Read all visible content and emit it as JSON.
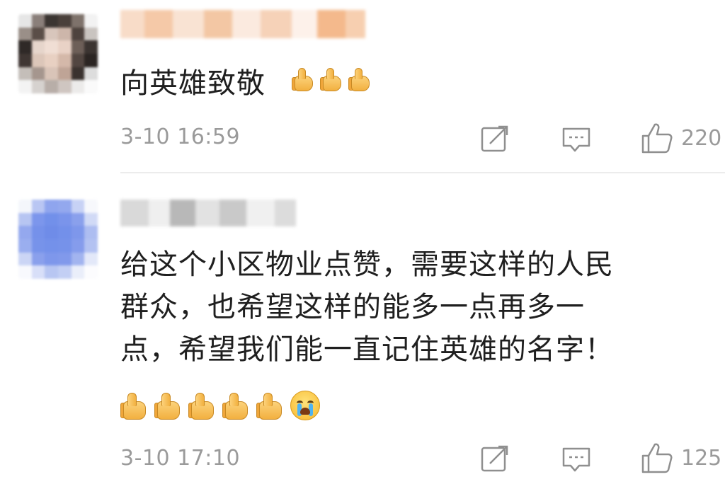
{
  "comments": [
    {
      "text": "向英雄致敬",
      "timestamp": "3-10 16:59",
      "emoji": [
        "thumbs-up",
        "thumbs-up",
        "thumbs-up"
      ],
      "like_count": "220"
    },
    {
      "text": "给这个小区物业点赞，需要这样的人民\n群众，也希望这样的能多一点再多一\n点，希望我们能一直记住英雄的名字！",
      "timestamp": "3-10 17:10",
      "emoji": [
        "thumbs-up",
        "thumbs-up",
        "thumbs-up",
        "thumbs-up",
        "thumbs-up",
        "crying-face"
      ],
      "like_count": "125"
    }
  ],
  "icons": {
    "share": "share-icon",
    "comment": "comment-icon",
    "like": "like-icon"
  },
  "colors": {
    "meta_gray": "#9a9a9a",
    "divider": "#ececec",
    "text": "#1f1f1f"
  }
}
